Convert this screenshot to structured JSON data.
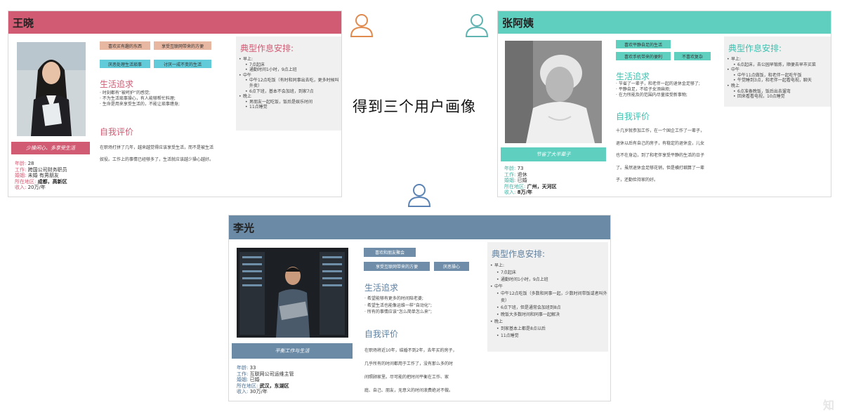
{
  "center_title": "得到三个用户画像",
  "watermark": "知乎",
  "colors": {
    "wang": "#d15b73",
    "zhang": "#5fd0c0",
    "li": "#6a8aa6",
    "tag_wang": "#e7b7a2",
    "tag_wang2": "#62cbd9",
    "tag_zhang": "#5fd0c0",
    "tag_li": "#6f8da8"
  },
  "personas": {
    "wang": {
      "name": "王晓",
      "banner": "少操闲心、多享受生活",
      "tags": [
        "喜欢买有趣的东西",
        "享受互联网带来的方便",
        "厌恶处理生活琐事",
        "讨厌一成不变的生活"
      ],
      "info": [
        {
          "k": "年龄: ",
          "v": "28"
        },
        {
          "k": "工作: ",
          "v": "跨国公司财务职员"
        },
        {
          "k": "婚姻: ",
          "v": "未婚 有男朋友"
        },
        {
          "k": "所在地区: ",
          "v": "成都，高新区"
        },
        {
          "k": "收入: ",
          "v": "20万/年"
        }
      ],
      "life_title": "生活追求",
      "life": [
        "时刻都有“被呵护”的感觉;",
        "不为生活琐事操心，有人能够帮忙料理;",
        "生命是用来享受生活的，不能让琐事缠身;"
      ],
      "eval_title": "自我评价",
      "eval_lines": [
        "在职场打拼了几年，越来越觉得应该享受生活，而不是被生活",
        "奴役。工作上的事情已经够多了，生活就应该越少操心越好。"
      ],
      "sched_title": "典型作息安排:",
      "schedule": [
        {
          "l": 1,
          "t": "早上:"
        },
        {
          "l": 2,
          "t": "7点起床"
        },
        {
          "l": 2,
          "t": "通勤时间1小时，9点上班"
        },
        {
          "l": 1,
          "t": "中午"
        },
        {
          "l": 2,
          "t": "中午12点吃饭（有时和同事出去吃，更多时候叫外卖）"
        },
        {
          "l": 2,
          "t": "6点下班，基本不会加班，到家7点"
        },
        {
          "l": 1,
          "t": "晚上"
        },
        {
          "l": 2,
          "t": "男朋友一起吃饭，饭后是娱乐时间"
        },
        {
          "l": 2,
          "t": "11点睡觉"
        }
      ]
    },
    "zhang": {
      "name": "张阿姨",
      "banner": "节省了大半辈子",
      "tags": [
        "喜欢平静自足的生活",
        "喜欢手机带来的便利",
        "不喜欢复杂"
      ],
      "info": [
        {
          "k": "年龄: ",
          "v": "73"
        },
        {
          "k": "工作: ",
          "v": "退休"
        },
        {
          "k": "婚姻: ",
          "v": "已婚"
        },
        {
          "k": "所在地区: ",
          "v": "广州，天河区"
        },
        {
          "k": "收入: ",
          "v": "8万/年"
        }
      ],
      "life_title": "生活追求",
      "life": [
        "节省了一辈子，和老伴一起的退休金足够了;",
        "平静自足，不给子女添麻烦;",
        "在力所能及的范围内尽量接受新事物;"
      ],
      "eval_title": "自我评价",
      "eval_lines": [
        "十几岁就参加工作，在一个国企工作了一辈子，",
        "退休以后有自己的房子，有稳定的退休金，儿女",
        "也不在身边，到了和老伴享受平静的生活的日子",
        "了。虽然退休金足够花销，但是横打细算了一辈",
        "子，还勤俭持家的好。"
      ],
      "sched_title": "典型作息安排:",
      "schedule": [
        {
          "l": 1,
          "t": "早上:"
        },
        {
          "l": 2,
          "t": "6点起床，去公园早锻炼，顺便去早市买菜"
        },
        {
          "l": 1,
          "t": "中午"
        },
        {
          "l": 2,
          "t": "中午11点做饭，和老伴一起吃午饭"
        },
        {
          "l": 2,
          "t": "午觉睡到3点，和老伴一起看电视，聊天"
        },
        {
          "l": 1,
          "t": "晚上"
        },
        {
          "l": 2,
          "t": "6点准备晚饭，饭后出去遛弯"
        },
        {
          "l": 2,
          "t": "回来看看电视，10点睡觉"
        }
      ]
    },
    "li": {
      "name": "李光",
      "banner": "平衡工作与生活",
      "tags": [
        "喜欢和朋友聚会",
        "享受互联网带来的方便",
        "厌恶操心"
      ],
      "info": [
        {
          "k": "年龄: ",
          "v": "33"
        },
        {
          "k": "工作: ",
          "v": "互联网公司运维主管"
        },
        {
          "k": "婚姻: ",
          "v": "已婚"
        },
        {
          "k": "所在地区: ",
          "v": "武汉，东湖区"
        },
        {
          "k": "收入: ",
          "v": "30万/年"
        }
      ],
      "life_title": "生活追求",
      "life": [
        "希望能够有更多的时间陪老婆;",
        "希望生活也能像运维一样“自动化”;",
        "所有的事情应该“怎么简单怎么来”;"
      ],
      "eval_title": "自我评价",
      "eval_lines": [
        "在职场将近10年，结婚不到2年，去年买的房子，",
        "几乎所有的时间都用于工作了，没有那么多的时",
        "间照顾家里。尽可能的把时间平衡在工作、家",
        "庭、自己、朋友，无意义的时间浪费绝对不做。"
      ],
      "sched_title": "典型作息安排:",
      "schedule": [
        {
          "l": 1,
          "t": "早上:"
        },
        {
          "l": 2,
          "t": "7点起床"
        },
        {
          "l": 2,
          "t": "通勤时间1小时，9点上班"
        },
        {
          "l": 1,
          "t": "中午"
        },
        {
          "l": 2,
          "t": "中午12点吃饭（多数和同事一起，少数时间带饭或者叫外卖）"
        },
        {
          "l": 2,
          "t": "6点下班，但是通常会加班到8点"
        },
        {
          "l": 2,
          "t": "晚饭大多数时间和同事一起解决"
        },
        {
          "l": 1,
          "t": "晚上"
        },
        {
          "l": 2,
          "t": "到家基本上都是8点以后"
        },
        {
          "l": 2,
          "t": "11点睡觉"
        }
      ]
    }
  }
}
